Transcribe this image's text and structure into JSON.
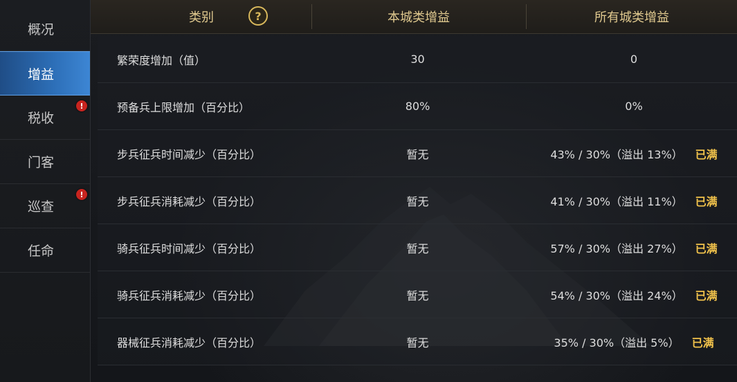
{
  "sidebar": {
    "items": [
      {
        "label": "概况",
        "active": false,
        "alert": false
      },
      {
        "label": "增益",
        "active": true,
        "alert": false
      },
      {
        "label": "税收",
        "active": false,
        "alert": true
      },
      {
        "label": "门客",
        "active": false,
        "alert": false
      },
      {
        "label": "巡查",
        "active": false,
        "alert": true
      },
      {
        "label": "任命",
        "active": false,
        "alert": false
      }
    ],
    "alert_glyph": "!"
  },
  "table": {
    "headers": {
      "category": "类别",
      "this_city": "本城类增益",
      "all_cities": "所有城类增益"
    },
    "help_glyph": "?",
    "full_label": "已满",
    "rows": [
      {
        "category": "繁荣度增加（值）",
        "this_city": "30",
        "all_cities": "0",
        "full": false
      },
      {
        "category": "预备兵上限增加（百分比）",
        "this_city": "80%",
        "all_cities": "0%",
        "full": false
      },
      {
        "category": "步兵征兵时间减少（百分比）",
        "this_city": "暂无",
        "all_cities": "43% / 30%（溢出 13%）",
        "full": true
      },
      {
        "category": "步兵征兵消耗减少（百分比）",
        "this_city": "暂无",
        "all_cities": "41% / 30%（溢出 11%）",
        "full": true
      },
      {
        "category": "骑兵征兵时间减少（百分比）",
        "this_city": "暂无",
        "all_cities": "57% / 30%（溢出 27%）",
        "full": true
      },
      {
        "category": "骑兵征兵消耗减少（百分比）",
        "this_city": "暂无",
        "all_cities": "54% / 30%（溢出 24%）",
        "full": true
      },
      {
        "category": "器械征兵消耗减少（百分比）",
        "this_city": "暂无",
        "all_cities": "35% / 30%（溢出 5%）",
        "full": true
      }
    ]
  },
  "colors": {
    "accent_gold": "#f1c24b",
    "header_text": "#e0c98f",
    "active_tab": "#2d6fb8",
    "alert_red": "#c8241f"
  }
}
